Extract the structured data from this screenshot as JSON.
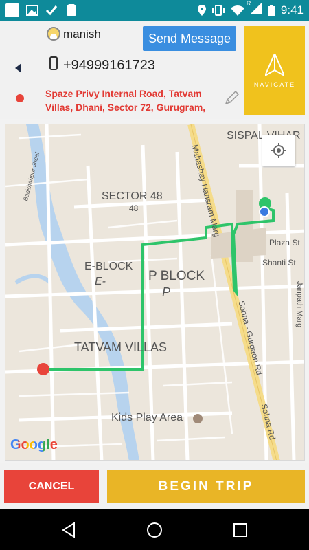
{
  "status_bar": {
    "time": "9:41",
    "icons": [
      "app-square-icon",
      "gallery-icon",
      "check-icon",
      "android-icon",
      "location-icon",
      "vibrate-icon",
      "wifi-icon",
      "signal-icon",
      "battery-icon"
    ],
    "roaming_label": "R"
  },
  "header": {
    "contact_name": "manish",
    "phone": "+94999161723",
    "send_message_label": "Send Message",
    "navigate_label": "NAVIGATE",
    "address": "Spaze Privy Internal Road, Tatvam Villas, Dhani, Sector 72, Gurugram,"
  },
  "map": {
    "labels": {
      "sispal_vihar": "SISPAL VIHAR",
      "sector_48": "SECTOR 48",
      "sector_48_num": "48",
      "e_block": "E-BLOCK",
      "e_block_short": "E-",
      "p_block": "P BLOCK",
      "p_block_short": "P",
      "tatvam_villas": "TATVAM VILLAS",
      "kids_play_area": "Kids Play Area",
      "plaza_st": "Plaza St",
      "shanti_st": "Shanti St",
      "mahashay_road": "Mahashay Hansram Marg",
      "sohna_gurgaon_rd": "Sohna - Gurgaon Rd",
      "sohna_rd": "Sohna Rd",
      "janpath_marg": "Janpath Marg",
      "badshahpur_jheel": "Badshahpur Jheel"
    },
    "attribution": "Google",
    "route_color": "#2ec46a",
    "origin_color": "#e8443a",
    "destination_color": "#3a7be0"
  },
  "actions": {
    "cancel_label": "CANCEL",
    "begin_trip_label": "BEGIN TRIP"
  }
}
